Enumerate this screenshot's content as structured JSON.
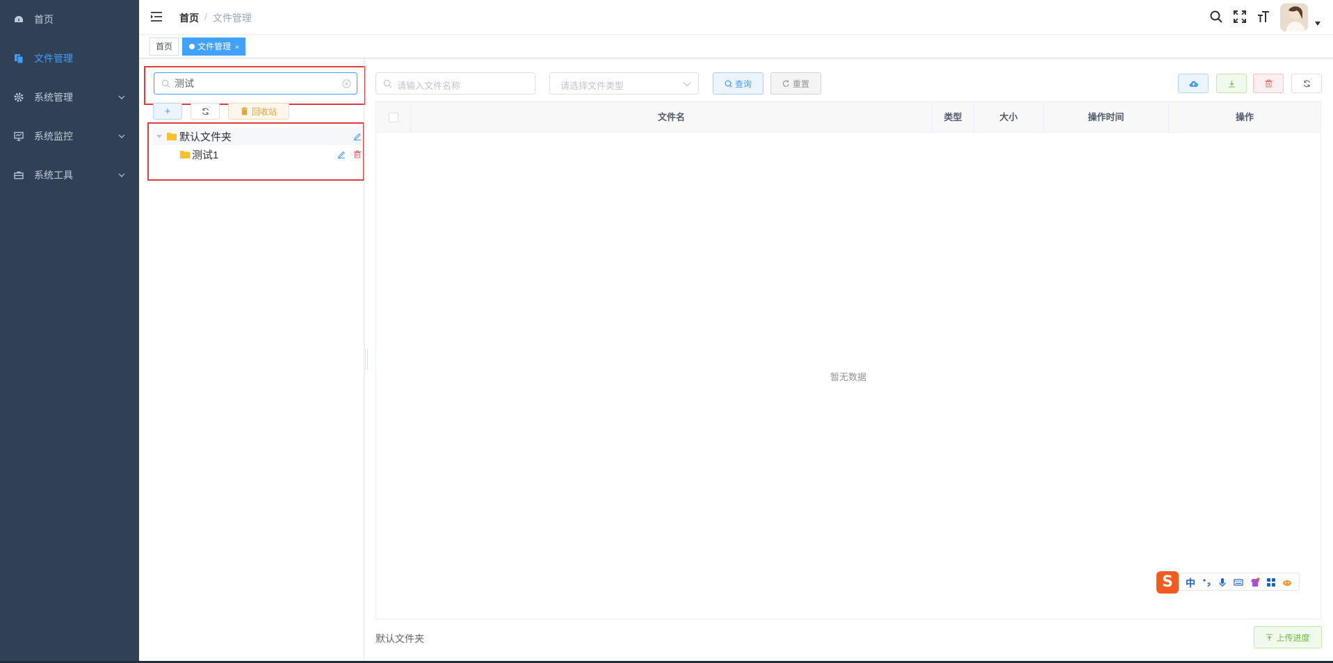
{
  "sidebar": {
    "items": [
      {
        "label": "首页",
        "icon": "dashboard-icon"
      },
      {
        "label": "文件管理",
        "icon": "files-icon",
        "active": true
      },
      {
        "label": "系统管理",
        "icon": "gear-icon",
        "has_children": true
      },
      {
        "label": "系统监控",
        "icon": "monitor-icon",
        "has_children": true
      },
      {
        "label": "系统工具",
        "icon": "toolbox-icon",
        "has_children": true
      }
    ]
  },
  "navbar": {
    "breadcrumb": {
      "home": "首页",
      "separator": "/",
      "current": "文件管理"
    },
    "icons": [
      "search-icon",
      "fullscreen-icon",
      "font-size-icon"
    ]
  },
  "tags": {
    "items": [
      {
        "label": "首页"
      },
      {
        "label": "文件管理",
        "active": true,
        "close": "×"
      }
    ]
  },
  "left_panel": {
    "search_value": "测试",
    "buttons": {
      "add": "+",
      "recycle": "回收站"
    },
    "tree": [
      {
        "label": "默认文件夹",
        "expanded": true
      },
      {
        "label": "测试1"
      }
    ]
  },
  "filters": {
    "name_placeholder": "请输入文件名称",
    "type_placeholder": "请选择文件类型",
    "query_label": "查询",
    "reset_label": "重置"
  },
  "table": {
    "columns": [
      "文件名",
      "类型",
      "大小",
      "操作时间",
      "操作"
    ],
    "empty_text": "暂无数据"
  },
  "footer": {
    "current_folder": "默认文件夹",
    "upload_progress_label": "上传进度"
  },
  "ime": {
    "logo": "S",
    "mode": "中"
  },
  "colors": {
    "sidebar_bg": "#304156",
    "primary": "#409eff",
    "danger": "#e4393c",
    "folder": "#f7c12c"
  }
}
